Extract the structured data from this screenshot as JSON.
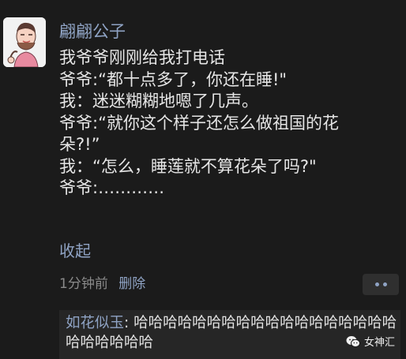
{
  "post": {
    "author": "翩翩公子",
    "avatar_icon": "cartoon-character-avatar",
    "lines": [
      "我爷爷刚刚给我打电话",
      "爷爷:“都十点多了，你还在睡!\"",
      "我：迷迷糊糊地嗯了几声。",
      "爷爷:“就你这个样子还怎么做祖国的花",
      "朵?!”",
      "我：“怎么，睡莲就不算花朵了吗?\"",
      "爷爷:…………"
    ],
    "collapse_label": "收起",
    "time": "1分钟前",
    "delete_label": "删除",
    "more_icon": "more-dots-icon"
  },
  "comments": [
    {
      "commenter": "如花似玉",
      "separator": ": ",
      "text": "哈哈哈哈哈哈哈哈哈哈哈哈哈哈哈哈哈哈哈哈哈哈哈哈"
    }
  ],
  "watermark": {
    "text": "女神汇",
    "icon": "wechat-bubble-icon"
  },
  "colors": {
    "background": "#1b1b1b",
    "link_blue": "#8fa3c4",
    "text": "#e6e6e6",
    "muted": "#8a8a8a",
    "comment_bg": "#262626"
  }
}
